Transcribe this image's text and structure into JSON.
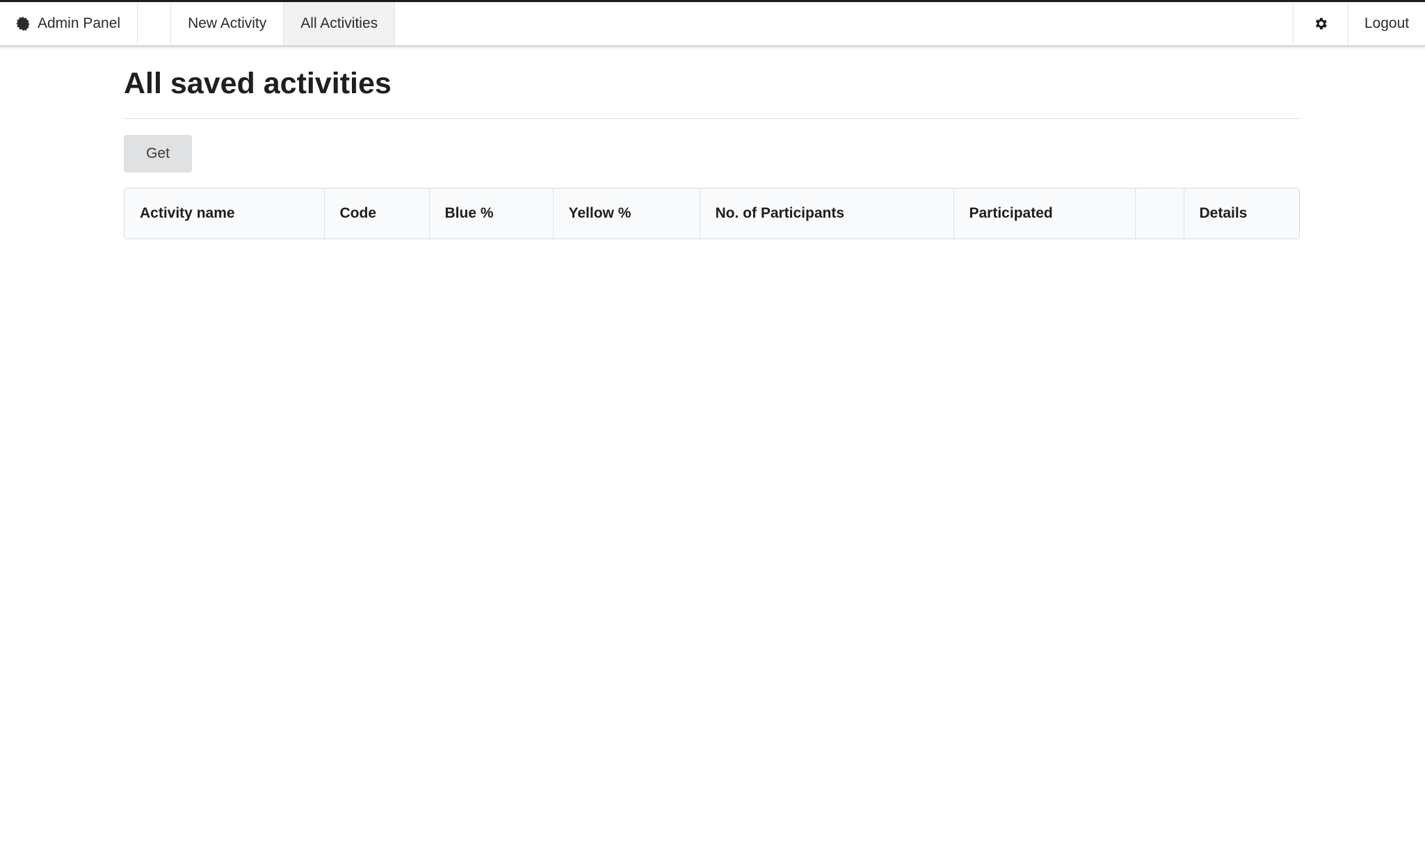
{
  "topbar": {
    "brand_label": "Admin Panel",
    "brand_icon": "badge-icon",
    "nav": [
      {
        "label": "New Activity",
        "active": false
      },
      {
        "label": "All Activities",
        "active": true
      }
    ],
    "settings_icon": "gear-icon",
    "logout_label": "Logout"
  },
  "main": {
    "title": "All saved activities",
    "get_button_label": "Get",
    "table": {
      "columns": [
        "Activity name",
        "Code",
        "Blue %",
        "Yellow %",
        "No. of Participants",
        "Participated",
        "",
        "Details"
      ],
      "rows": []
    }
  },
  "colors": {
    "top_border": "#1b1c1d",
    "active_tab_bg": "#f2f2f2",
    "button_bg": "#e0e1e2",
    "table_header_bg": "#f9fafb"
  }
}
